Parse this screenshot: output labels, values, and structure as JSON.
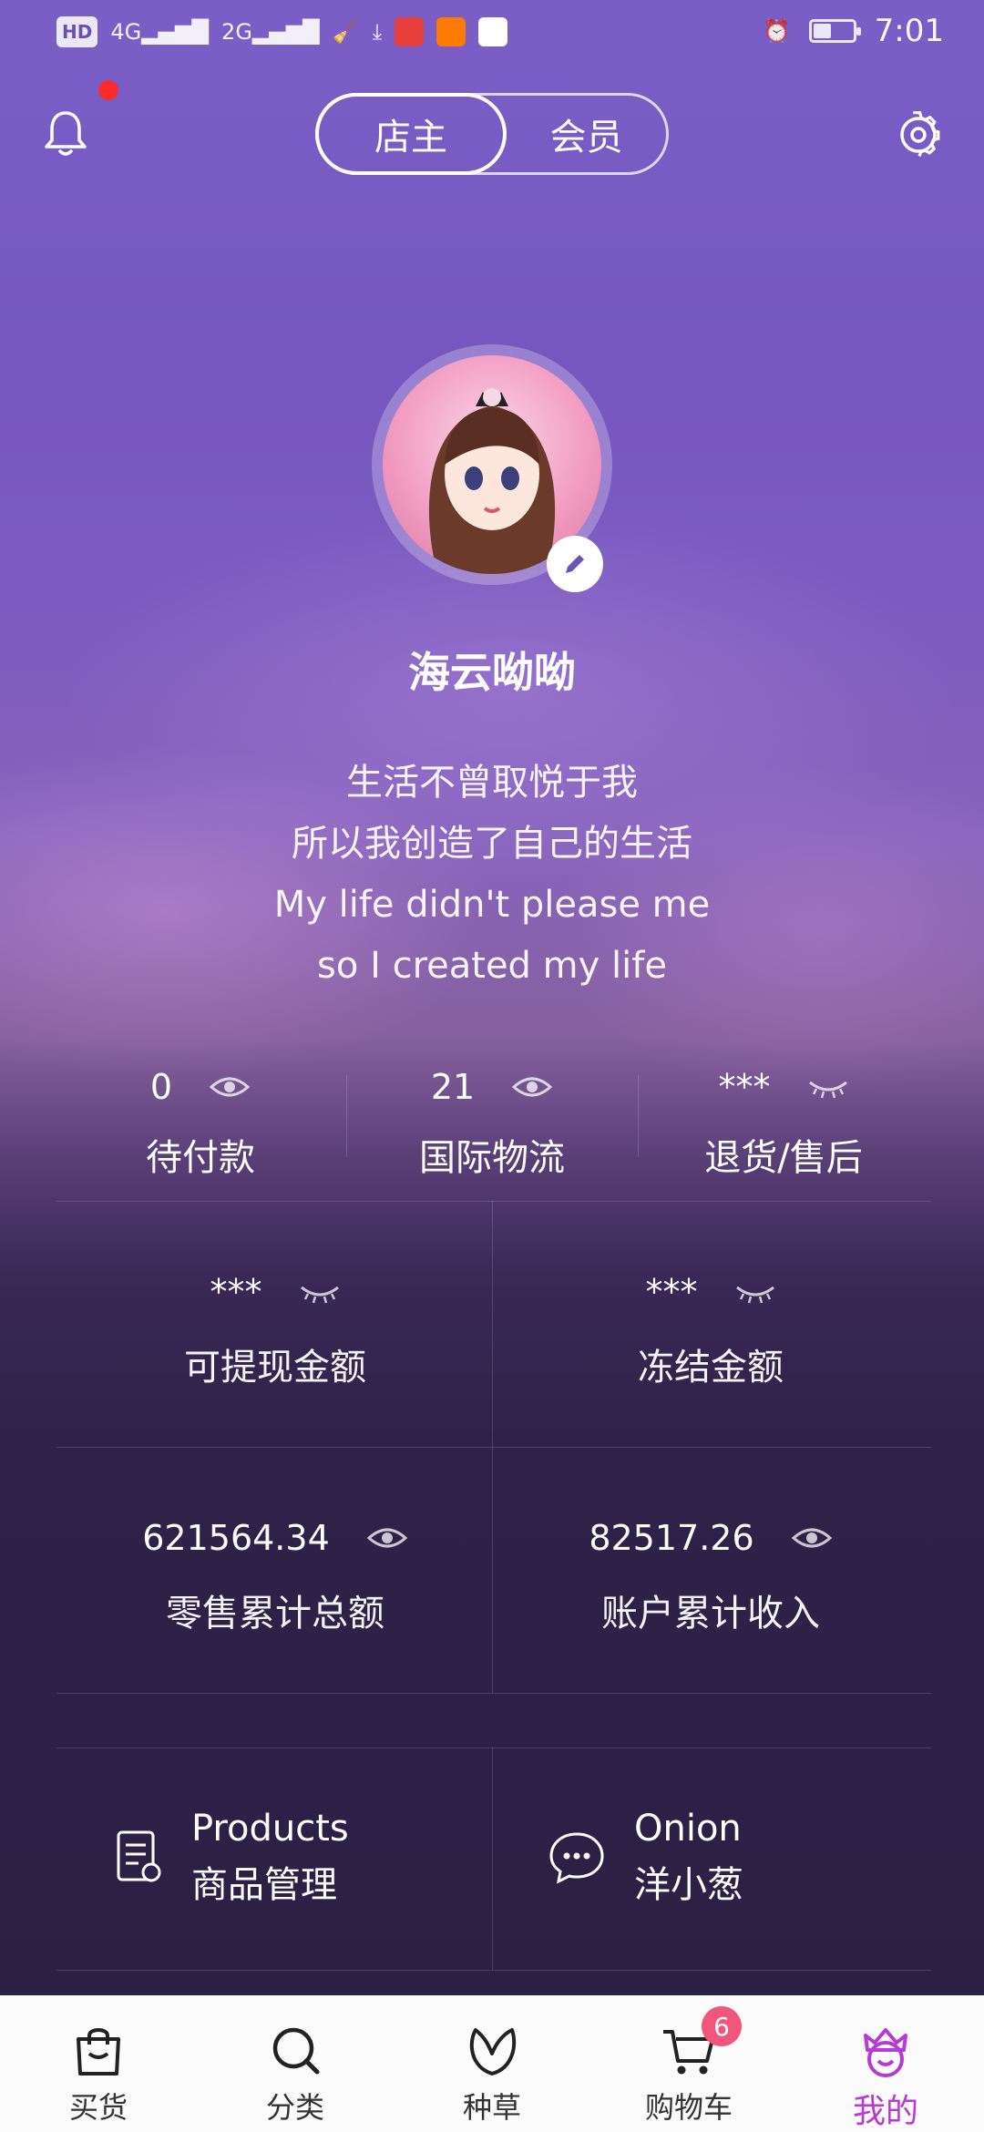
{
  "status_bar": {
    "left_chip": "HD",
    "signal_1": "4G",
    "signal_2": "2G",
    "time": "7:01",
    "battery_level": 0.45
  },
  "header": {
    "segment_tabs": [
      {
        "label": "店主",
        "active": true
      },
      {
        "label": "会员",
        "active": false
      }
    ]
  },
  "profile": {
    "username": "海云呦呦",
    "bio_lines": [
      "生活不曾取悦于我",
      "所以我创造了自己的生活",
      "My life didn't please me",
      "so I created my life"
    ]
  },
  "stats": [
    {
      "value": "0",
      "label": "待付款",
      "eye": "open"
    },
    {
      "value": "21",
      "label": "国际物流",
      "eye": "open"
    },
    {
      "value": "***",
      "label": "退货/售后",
      "eye": "closed"
    }
  ],
  "balances": [
    {
      "value": "***",
      "label": "可提现金额",
      "eye": "closed"
    },
    {
      "value": "***",
      "label": "冻结金额",
      "eye": "closed"
    },
    {
      "value": "621564.34",
      "label": "零售累计总额",
      "eye": "open"
    },
    {
      "value": "82517.26",
      "label": "账户累计收入",
      "eye": "open"
    }
  ],
  "features": [
    {
      "en": "Products",
      "zh": "商品管理",
      "icon": "product-list-icon"
    },
    {
      "en": "Onion",
      "zh": "洋小葱",
      "icon": "chat-bubble-icon"
    }
  ],
  "tabbar": {
    "items": [
      {
        "label": "买货",
        "icon": "shopping-bag-icon"
      },
      {
        "label": "分类",
        "icon": "search-icon"
      },
      {
        "label": "种草",
        "icon": "leaf-icon"
      },
      {
        "label": "购物车",
        "icon": "cart-icon",
        "badge": "6"
      },
      {
        "label": "我的",
        "icon": "crown-face-icon",
        "active": true
      }
    ],
    "active_color": "#b63ad4"
  }
}
